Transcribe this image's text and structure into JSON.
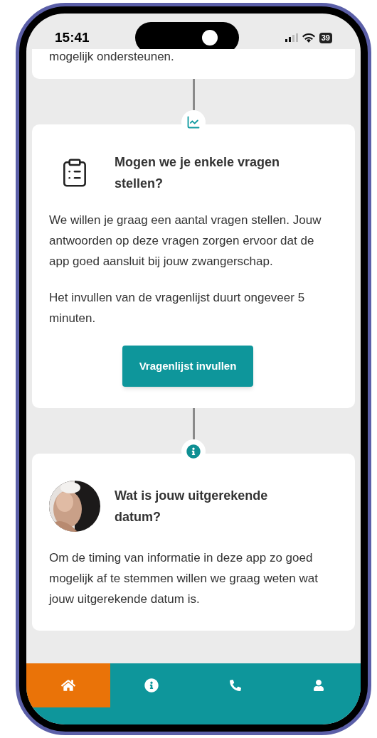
{
  "status_bar": {
    "time": "15:41",
    "battery": "39"
  },
  "top_card": {
    "text": "mogelijk ondersteunen."
  },
  "cards": [
    {
      "kind": "questionnaire",
      "title": "Mogen we je enkele vragen stellen?",
      "paragraphs": [
        "We willen je graag een aantal vragen stellen. Jouw antwoorden op deze vragen zorgen ervoor dat de app goed aansluit bij jouw zwangerschap.",
        "Het invullen van de vragenlijst duurt ongeveer 5 minuten."
      ],
      "button": "Vragenlijst invullen"
    },
    {
      "title": "Wat is jouw uitgerekende datum?",
      "paragraphs": [
        "Om de timing van informatie in deze app zo goed mogelijk af te stemmen willen we graag weten wat jouw uitgerekende datum is."
      ]
    }
  ],
  "nav": [
    {
      "kind": "home",
      "selected": true
    },
    {
      "kind": "info",
      "selected": false
    },
    {
      "kind": "phone",
      "selected": false
    },
    {
      "kind": "user",
      "selected": false
    }
  ]
}
